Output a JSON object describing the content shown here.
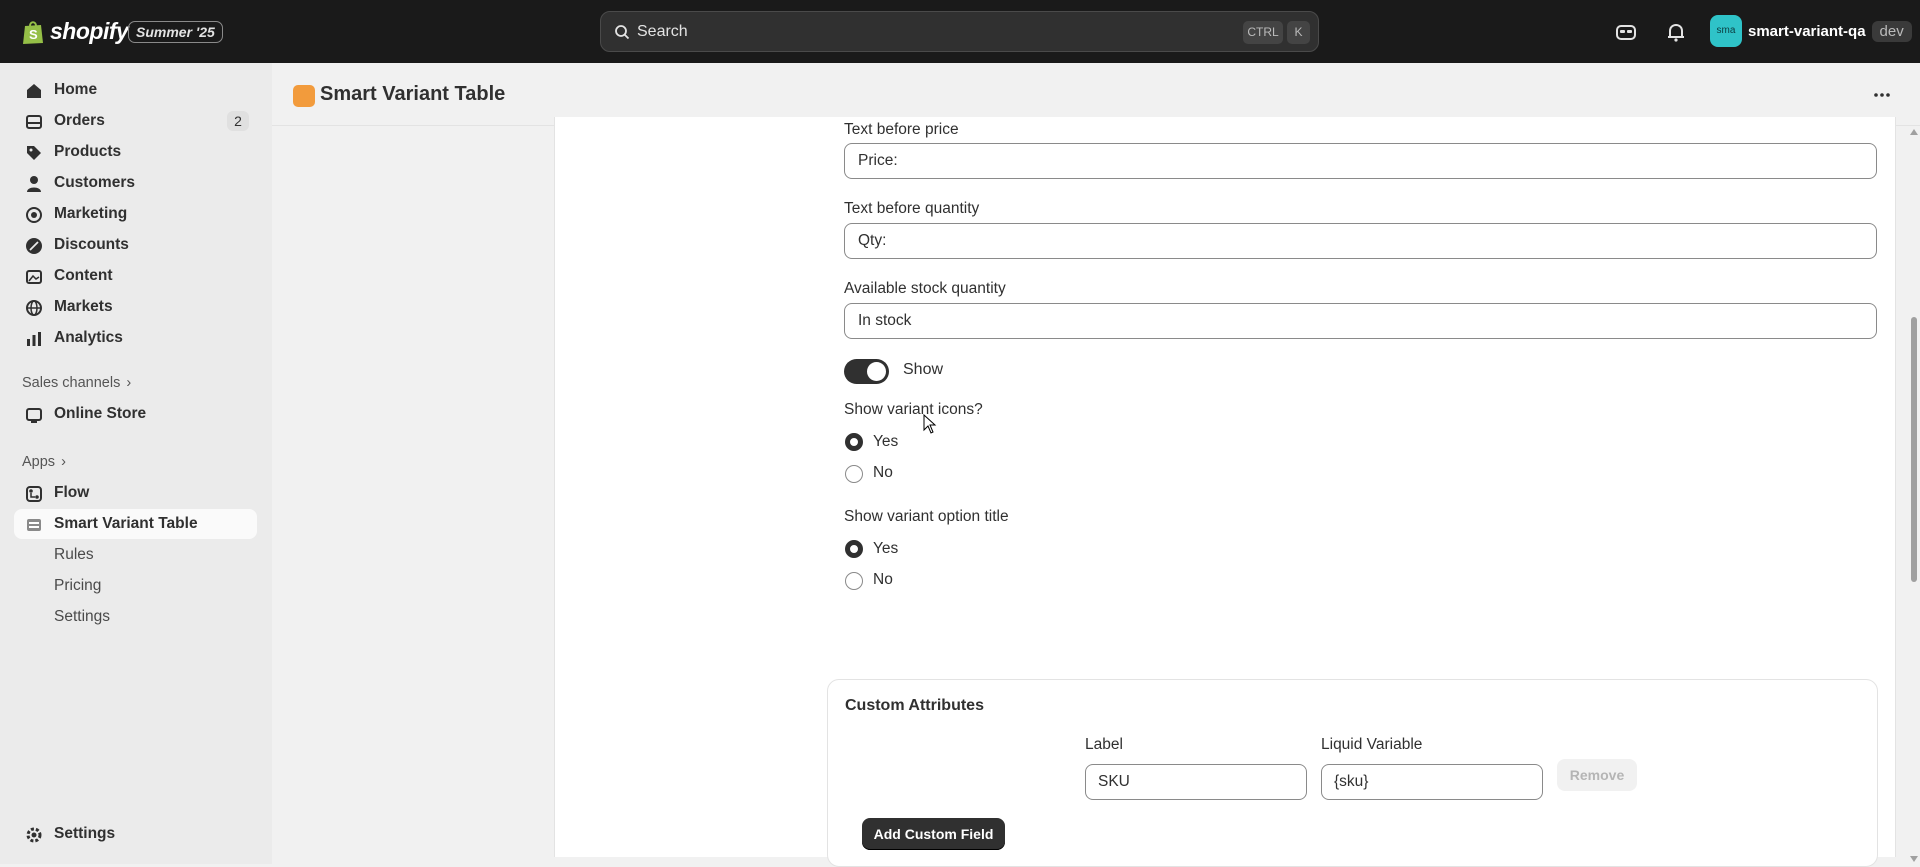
{
  "topbar": {
    "brand": "shopify",
    "edition": "Summer '25",
    "search_placeholder": "Search",
    "kbd_ctrl": "CTRL",
    "kbd_k": "K",
    "store_avatar": "sma",
    "store_name": "smart-variant-qa",
    "store_badge": "dev"
  },
  "sidebar": {
    "items": [
      {
        "label": "Home",
        "icon": "home-icon"
      },
      {
        "label": "Orders",
        "icon": "orders-icon",
        "count": "2"
      },
      {
        "label": "Products",
        "icon": "tag-icon"
      },
      {
        "label": "Customers",
        "icon": "person-icon"
      },
      {
        "label": "Marketing",
        "icon": "target-icon"
      },
      {
        "label": "Discounts",
        "icon": "discount-icon"
      },
      {
        "label": "Content",
        "icon": "image-icon"
      },
      {
        "label": "Markets",
        "icon": "globe-icon"
      },
      {
        "label": "Analytics",
        "icon": "chart-icon"
      }
    ],
    "sales_channels_label": "Sales channels",
    "online_store": "Online Store",
    "apps_label": "Apps",
    "flow": "Flow",
    "app_name": "Smart Variant Table",
    "app_sub": [
      "Rules",
      "Pricing",
      "Settings"
    ],
    "settings": "Settings"
  },
  "header": {
    "title": "Smart Variant Table"
  },
  "form": {
    "text_before_price_label": "Text before price",
    "text_before_price_value": "Price:",
    "text_before_qty_label": "Text before quantity",
    "text_before_qty_value": "Qty:",
    "stock_label": "Available stock quantity",
    "stock_value": "In stock",
    "toggle_label": "Show",
    "toggle_on": true,
    "variant_icons_label": "Show variant icons?",
    "variant_icons_options": [
      "Yes",
      "No"
    ],
    "variant_icons_selected": "Yes",
    "option_title_label": "Show variant option title",
    "option_title_options": [
      "Yes",
      "No"
    ],
    "option_title_selected": "Yes"
  },
  "custom_attributes": {
    "title": "Custom Attributes",
    "label_header": "Label",
    "liquid_header": "Liquid Variable",
    "rows": [
      {
        "label": "SKU",
        "liquid": "{sku}"
      }
    ],
    "remove_label": "Remove",
    "add_label": "Add Custom Field"
  },
  "colors": {
    "topbar_bg": "#1a1a1a",
    "sidebar_bg": "#ebebeb",
    "primary_button": "#303030",
    "app_icon": "#f29b3c",
    "store_avatar": "#2fc3c8"
  }
}
